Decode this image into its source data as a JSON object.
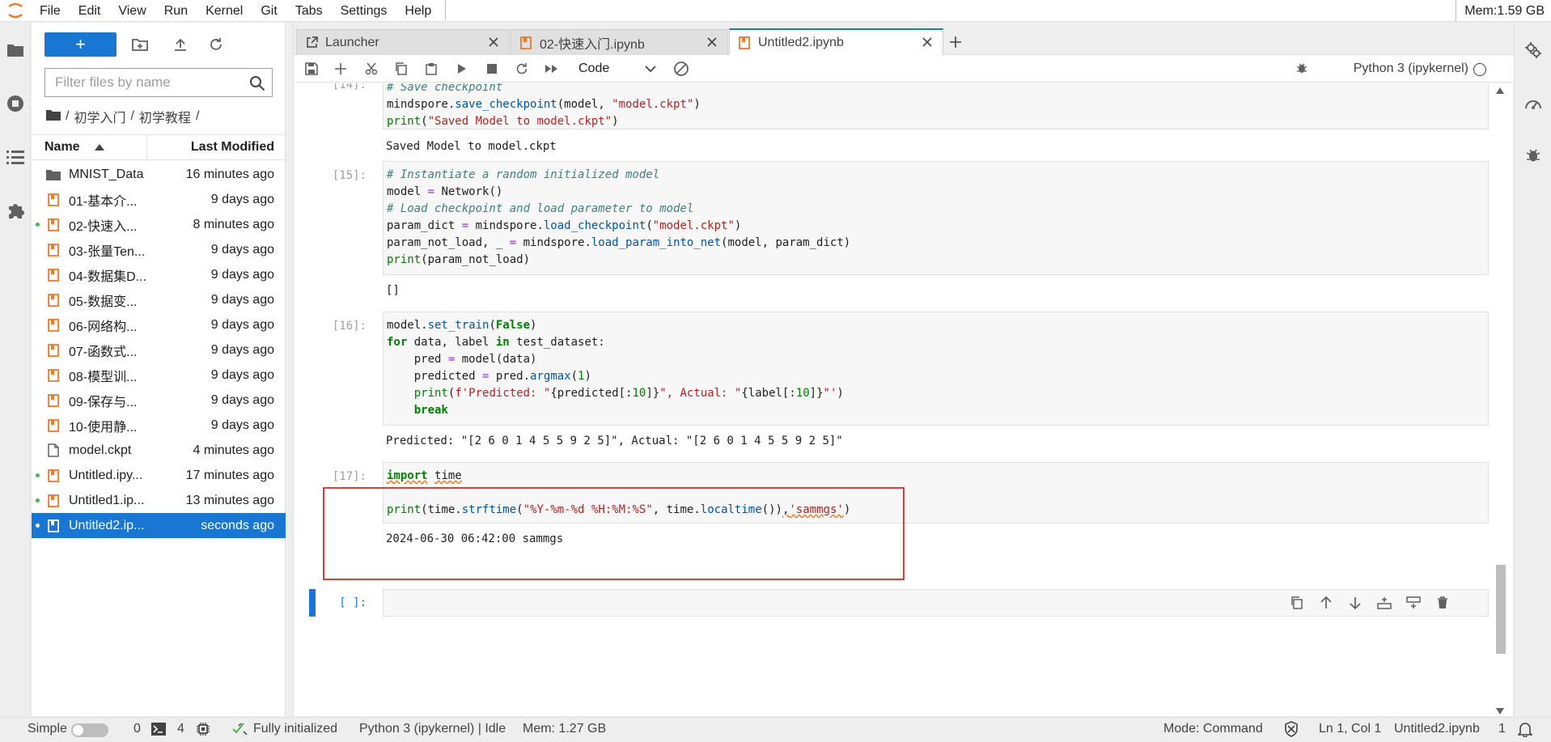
{
  "menubar": {
    "items": [
      "File",
      "Edit",
      "View",
      "Run",
      "Kernel",
      "Git",
      "Tabs",
      "Settings",
      "Help"
    ],
    "memory": "Mem:1.59 GB"
  },
  "filebrowser": {
    "new_label": "+",
    "filter_placeholder": "Filter files by name",
    "breadcrumb": [
      "/",
      "初学入门",
      "/",
      "初学教程",
      "/"
    ],
    "col_name": "Name",
    "col_modified": "Last Modified",
    "files": [
      {
        "name": "MNIST_Data",
        "modified": "16 minutes ago",
        "type": "folder",
        "running": false,
        "selected": false
      },
      {
        "name": "01-基本介...",
        "modified": "9 days ago",
        "type": "notebook",
        "running": false,
        "selected": false
      },
      {
        "name": "02-快速入...",
        "modified": "8 minutes ago",
        "type": "notebook",
        "running": true,
        "selected": false
      },
      {
        "name": "03-张量Ten...",
        "modified": "9 days ago",
        "type": "notebook",
        "running": false,
        "selected": false
      },
      {
        "name": "04-数据集D...",
        "modified": "9 days ago",
        "type": "notebook",
        "running": false,
        "selected": false
      },
      {
        "name": "05-数据变...",
        "modified": "9 days ago",
        "type": "notebook",
        "running": false,
        "selected": false
      },
      {
        "name": "06-网络构...",
        "modified": "9 days ago",
        "type": "notebook",
        "running": false,
        "selected": false
      },
      {
        "name": "07-函数式...",
        "modified": "9 days ago",
        "type": "notebook",
        "running": false,
        "selected": false
      },
      {
        "name": "08-模型训...",
        "modified": "9 days ago",
        "type": "notebook",
        "running": false,
        "selected": false
      },
      {
        "name": "09-保存与...",
        "modified": "9 days ago",
        "type": "notebook",
        "running": false,
        "selected": false
      },
      {
        "name": "10-使用静...",
        "modified": "9 days ago",
        "type": "notebook",
        "running": false,
        "selected": false
      },
      {
        "name": "model.ckpt",
        "modified": "4 minutes ago",
        "type": "file",
        "running": false,
        "selected": false
      },
      {
        "name": "Untitled.ipy...",
        "modified": "17 minutes ago",
        "type": "notebook",
        "running": true,
        "selected": false
      },
      {
        "name": "Untitled1.ip...",
        "modified": "13 minutes ago",
        "type": "notebook",
        "running": true,
        "selected": false
      },
      {
        "name": "Untitled2.ip...",
        "modified": "seconds ago",
        "type": "notebook",
        "running": true,
        "selected": true
      }
    ]
  },
  "tabs": [
    {
      "label": "Launcher",
      "icon": "launcher-icon",
      "active": false
    },
    {
      "label": "02-快速入门.ipynb",
      "icon": "notebook-icon",
      "active": false
    },
    {
      "label": "Untitled2.ipynb",
      "icon": "notebook-icon",
      "active": true
    }
  ],
  "toolbar": {
    "cell_type": "Code",
    "kernel": "Python 3 (ipykernel)"
  },
  "cells": {
    "c14": {
      "prompt": "[14]:",
      "lines": [
        "# Save checkpoint",
        "mindspore.save_checkpoint(model, \"model.ckpt\")",
        "print(\"Saved Model to model.ckpt\")"
      ],
      "output": "Saved Model to model.ckpt"
    },
    "c15": {
      "prompt": "[15]:",
      "lines": [
        "# Instantiate a random initialized model",
        "model = Network()",
        "# Load checkpoint and load parameter to model",
        "param_dict = mindspore.load_checkpoint(\"model.ckpt\")",
        "param_not_load, _ = mindspore.load_param_into_net(model, param_dict)",
        "print(param_not_load)"
      ],
      "output": "[]"
    },
    "c16": {
      "prompt": "[16]:",
      "lines": [
        "model.set_train(False)",
        "for data, label in test_dataset:",
        "    pred = model(data)",
        "    predicted = pred.argmax(1)",
        "    print(f'Predicted: \"{predicted[:10]}\", Actual: \"{label[:10]}\"')",
        "    break"
      ],
      "output": "Predicted: \"[2 6 0 1 4 5 5 9 2 5]\", Actual: \"[2 6 0 1 4 5 5 9 2 5]\""
    },
    "c17": {
      "prompt": "[17]:",
      "lines": [
        "import time",
        "",
        "print(time.strftime(\"%Y-%m-%d %H:%M:%S\", time.localtime()),'sammgs')"
      ],
      "output": "2024-06-30 06:42:00 sammgs"
    },
    "empty": {
      "prompt": "[ ]:"
    }
  },
  "statusbar": {
    "mode_simple": "Simple",
    "terminals": "0",
    "kernels": "4",
    "init": "Fully initialized",
    "kernel_status": "Python 3 (ipykernel) | Idle",
    "memory": "Mem: 1.27 GB",
    "mode": "Mode: Command",
    "position": "Ln 1, Col 1",
    "filename": "Untitled2.ipynb",
    "notifications": "1"
  },
  "colors": {
    "accent": "#1976d2",
    "highlight": "#e53935",
    "notebook_icon": "#f37726"
  }
}
